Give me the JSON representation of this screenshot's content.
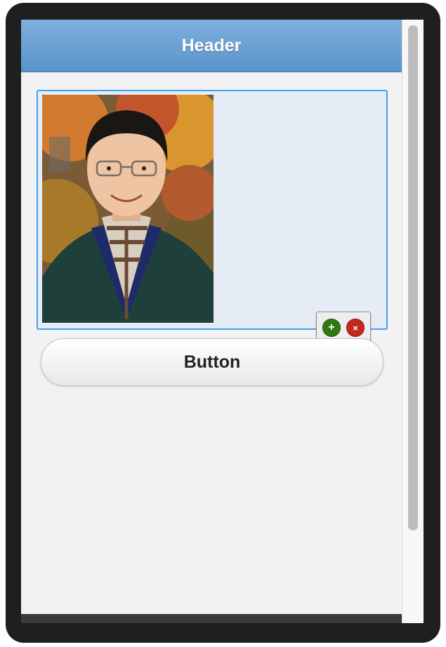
{
  "header": {
    "title": "Header"
  },
  "image": {
    "alt": "Portrait photo of a smiling man with glasses in front of autumn trees"
  },
  "edit_toolbar": {
    "add_icon": "plus-circle-icon",
    "remove_icon": "close-circle-icon",
    "add_glyph": "+",
    "remove_glyph": "×",
    "add_color": "#2f7a0f",
    "remove_color": "#c2291d"
  },
  "button": {
    "label": "Button"
  },
  "colors": {
    "header": "#5a93cb",
    "selection_border": "#3fa2f0",
    "device_frame": "#1f1f1f"
  }
}
